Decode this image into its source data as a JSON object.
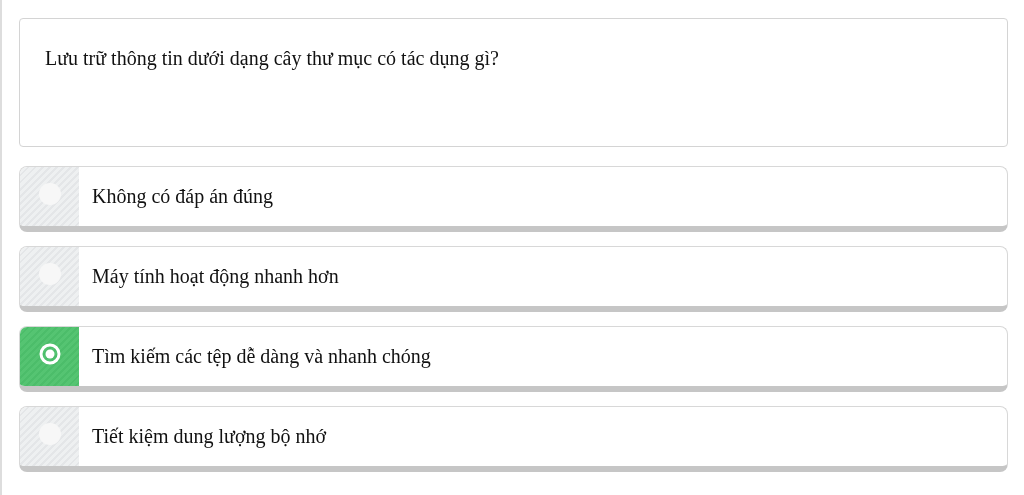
{
  "question": "Lưu trữ thông tin dưới dạng cây thư mục có tác dụng gì?",
  "options": [
    {
      "label": "Không có đáp án đúng",
      "selected": false
    },
    {
      "label": "Máy tính hoạt động nhanh hơn",
      "selected": false
    },
    {
      "label": "Tìm kiếm các tệp dễ dàng và nhanh chóng",
      "selected": true
    },
    {
      "label": "Tiết kiệm dung lượng bộ nhớ",
      "selected": false
    }
  ]
}
